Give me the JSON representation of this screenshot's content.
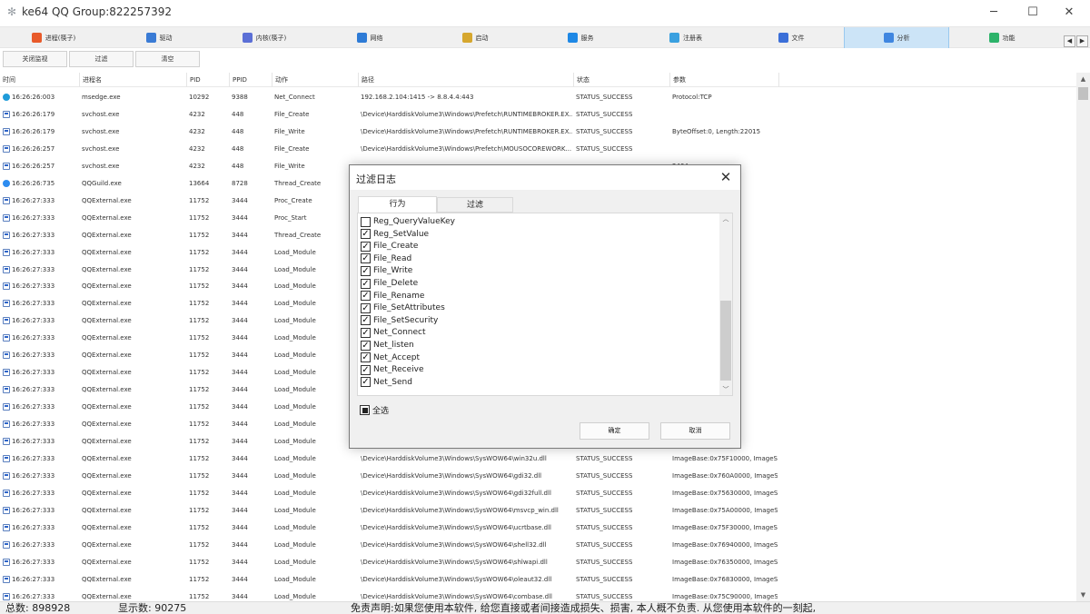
{
  "window": {
    "title": "ke64 QQ Group:822257392",
    "app_icon": "gear-icon",
    "minimize": "─",
    "maximize": "☐",
    "close": "✕"
  },
  "tabs": [
    {
      "label": "进程(筷子)",
      "icon": "windows-icon",
      "color": "#e85a2a"
    },
    {
      "label": "驱动",
      "icon": "gear-icon",
      "color": "#3a7bd5"
    },
    {
      "label": "内核(筷子)",
      "icon": "chip-icon",
      "color": "#5b6fd6"
    },
    {
      "label": "网络",
      "icon": "network-icon",
      "color": "#2e7bd6"
    },
    {
      "label": "启动",
      "icon": "rocket-icon",
      "color": "#d6a72e"
    },
    {
      "label": "服务",
      "icon": "services-icon",
      "color": "#1e88e5"
    },
    {
      "label": "注册表",
      "icon": "registry-icon",
      "color": "#3aa0e0"
    },
    {
      "label": "文件",
      "icon": "file-icon",
      "color": "#3b6fd8"
    },
    {
      "label": "分析",
      "icon": "analysis-icon",
      "color": "#3f86e0"
    },
    {
      "label": "功能",
      "icon": "function-icon",
      "color": "#2db36a"
    }
  ],
  "active_tab": "分析",
  "tab_nav": {
    "prev": "◀",
    "next": "▶"
  },
  "toolbar": {
    "close_monitor": "关闭监视",
    "filter": "过滤",
    "clear": "清空"
  },
  "columns": [
    "时间",
    "进程名",
    "PID",
    "PPID",
    "动作",
    "路径",
    "状态",
    "参数"
  ],
  "rows": [
    {
      "icon": "edge",
      "time": "16:26:26:003",
      "proc": "msedge.exe",
      "pid": "10292",
      "ppid": "9388",
      "action": "Net_Connect",
      "path": "192.168.2.104:1415  ->  8.8.4.4:443",
      "status": "STATUS_SUCCESS",
      "param": "Protocol:TCP"
    },
    {
      "icon": "exe",
      "time": "16:26:26:179",
      "proc": "svchost.exe",
      "pid": "4232",
      "ppid": "448",
      "action": "File_Create",
      "path": "\\Device\\HarddiskVolume3\\Windows\\Prefetch\\RUNTIMEBROKER.EX...",
      "status": "STATUS_SUCCESS",
      "param": ""
    },
    {
      "icon": "exe",
      "time": "16:26:26:179",
      "proc": "svchost.exe",
      "pid": "4232",
      "ppid": "448",
      "action": "File_Write",
      "path": "\\Device\\HarddiskVolume3\\Windows\\Prefetch\\RUNTIMEBROKER.EX...",
      "status": "STATUS_SUCCESS",
      "param": "ByteOffset:0, Length:22015"
    },
    {
      "icon": "exe",
      "time": "16:26:26:257",
      "proc": "svchost.exe",
      "pid": "4232",
      "ppid": "448",
      "action": "File_Create",
      "path": "\\Device\\HarddiskVolume3\\Windows\\Prefetch\\MOUSOCOREWORK...",
      "status": "STATUS_SUCCESS",
      "param": ""
    },
    {
      "icon": "exe",
      "time": "16:26:26:257",
      "proc": "svchost.exe",
      "pid": "4232",
      "ppid": "448",
      "action": "File_Write",
      "path": "",
      "status": "",
      "param": "2464"
    },
    {
      "icon": "guild",
      "time": "16:26:26:735",
      "proc": "QQGuild.exe",
      "pid": "13664",
      "ppid": "8728",
      "action": "Thread_Create",
      "path": "",
      "status": "",
      "param": ""
    },
    {
      "icon": "exe",
      "time": "16:26:27:333",
      "proc": "QQExternal.exe",
      "pid": "11752",
      "ppid": "3444",
      "action": "Proc_Create",
      "path": "",
      "status": "",
      "param": ""
    },
    {
      "icon": "exe",
      "time": "16:26:27:333",
      "proc": "QQExternal.exe",
      "pid": "11752",
      "ppid": "3444",
      "action": "Proc_Start",
      "path": "",
      "status": "",
      "param": ""
    },
    {
      "icon": "exe",
      "time": "16:26:27:333",
      "proc": "QQExternal.exe",
      "pid": "11752",
      "ppid": "3444",
      "action": "Thread_Create",
      "path": "",
      "status": "",
      "param": ""
    },
    {
      "icon": "exe",
      "time": "16:26:27:333",
      "proc": "QQExternal.exe",
      "pid": "11752",
      "ppid": "3444",
      "action": "Load_Module",
      "path": "",
      "status": "",
      "param": "ImageSize..."
    },
    {
      "icon": "exe",
      "time": "16:26:27:333",
      "proc": "QQExternal.exe",
      "pid": "11752",
      "ppid": "3444",
      "action": "Load_Module",
      "path": "",
      "status": "",
      "param": "0000, Im..."
    },
    {
      "icon": "exe",
      "time": "16:26:27:333",
      "proc": "QQExternal.exe",
      "pid": "11752",
      "ppid": "3444",
      "action": "Load_Module",
      "path": "",
      "status": "",
      "param": "0, ImageS..."
    },
    {
      "icon": "exe",
      "time": "16:26:27:333",
      "proc": "QQExternal.exe",
      "pid": "11752",
      "ppid": "3444",
      "action": "Load_Module",
      "path": "",
      "status": "",
      "param": "0000, Ima..."
    },
    {
      "icon": "exe",
      "time": "16:26:27:333",
      "proc": "QQExternal.exe",
      "pid": "11752",
      "ppid": "3444",
      "action": "Load_Module",
      "path": "",
      "status": "",
      "param": "0000, Ima..."
    },
    {
      "icon": "exe",
      "time": "16:26:27:333",
      "proc": "QQExternal.exe",
      "pid": "11752",
      "ppid": "3444",
      "action": "Load_Module",
      "path": "",
      "status": "",
      "param": "0, ImageSi..."
    },
    {
      "icon": "exe",
      "time": "16:26:27:333",
      "proc": "QQExternal.exe",
      "pid": "11752",
      "ppid": "3444",
      "action": "Load_Module",
      "path": "",
      "status": "",
      "param": "0, ImageSi..."
    },
    {
      "icon": "exe",
      "time": "16:26:27:333",
      "proc": "QQExternal.exe",
      "pid": "11752",
      "ppid": "3444",
      "action": "Load_Module",
      "path": "",
      "status": "",
      "param": "0, ImageSi..."
    },
    {
      "icon": "exe",
      "time": "16:26:27:333",
      "proc": "QQExternal.exe",
      "pid": "11752",
      "ppid": "3444",
      "action": "Load_Module",
      "path": "",
      "status": "",
      "param": "0, ImageS..."
    },
    {
      "icon": "exe",
      "time": "16:26:27:333",
      "proc": "QQExternal.exe",
      "pid": "11752",
      "ppid": "3444",
      "action": "Load_Module",
      "path": "",
      "status": "",
      "param": "0, ImageSi..."
    },
    {
      "icon": "exe",
      "time": "16:26:27:333",
      "proc": "QQExternal.exe",
      "pid": "11752",
      "ppid": "3444",
      "action": "Load_Module",
      "path": "",
      "status": "",
      "param": "0, ImageSi..."
    },
    {
      "icon": "exe",
      "time": "16:26:27:333",
      "proc": "QQExternal.exe",
      "pid": "11752",
      "ppid": "3444",
      "action": "Load_Module",
      "path": "",
      "status": "",
      "param": "0, ImageSi..."
    },
    {
      "icon": "exe",
      "time": "16:26:27:333",
      "proc": "QQExternal.exe",
      "pid": "11752",
      "ppid": "3444",
      "action": "Load_Module",
      "path": "\\Device\\HarddiskVolume3\\Windows\\SysWOW64\\win32u.dll",
      "status": "STATUS_SUCCESS",
      "param": "ImageBase:0x75F10000, ImageSi..."
    },
    {
      "icon": "exe",
      "time": "16:26:27:333",
      "proc": "QQExternal.exe",
      "pid": "11752",
      "ppid": "3444",
      "action": "Load_Module",
      "path": "\\Device\\HarddiskVolume3\\Windows\\SysWOW64\\gdi32.dll",
      "status": "STATUS_SUCCESS",
      "param": "ImageBase:0x760A0000, ImageSi..."
    },
    {
      "icon": "exe",
      "time": "16:26:27:333",
      "proc": "QQExternal.exe",
      "pid": "11752",
      "ppid": "3444",
      "action": "Load_Module",
      "path": "\\Device\\HarddiskVolume3\\Windows\\SysWOW64\\gdi32full.dll",
      "status": "STATUS_SUCCESS",
      "param": "ImageBase:0x75630000, ImageSi..."
    },
    {
      "icon": "exe",
      "time": "16:26:27:333",
      "proc": "QQExternal.exe",
      "pid": "11752",
      "ppid": "3444",
      "action": "Load_Module",
      "path": "\\Device\\HarddiskVolume3\\Windows\\SysWOW64\\msvcp_win.dll",
      "status": "STATUS_SUCCESS",
      "param": "ImageBase:0x75A00000, ImageSi..."
    },
    {
      "icon": "exe",
      "time": "16:26:27:333",
      "proc": "QQExternal.exe",
      "pid": "11752",
      "ppid": "3444",
      "action": "Load_Module",
      "path": "\\Device\\HarddiskVolume3\\Windows\\SysWOW64\\ucrtbase.dll",
      "status": "STATUS_SUCCESS",
      "param": "ImageBase:0x75F30000, ImageSi..."
    },
    {
      "icon": "exe",
      "time": "16:26:27:333",
      "proc": "QQExternal.exe",
      "pid": "11752",
      "ppid": "3444",
      "action": "Load_Module",
      "path": "\\Device\\HarddiskVolume3\\Windows\\SysWOW64\\shell32.dll",
      "status": "STATUS_SUCCESS",
      "param": "ImageBase:0x76940000, ImageSi..."
    },
    {
      "icon": "exe",
      "time": "16:26:27:333",
      "proc": "QQExternal.exe",
      "pid": "11752",
      "ppid": "3444",
      "action": "Load_Module",
      "path": "\\Device\\HarddiskVolume3\\Windows\\SysWOW64\\shlwapi.dll",
      "status": "STATUS_SUCCESS",
      "param": "ImageBase:0x76350000, ImageSi..."
    },
    {
      "icon": "exe",
      "time": "16:26:27:333",
      "proc": "QQExternal.exe",
      "pid": "11752",
      "ppid": "3444",
      "action": "Load_Module",
      "path": "\\Device\\HarddiskVolume3\\Windows\\SysWOW64\\oleaut32.dll",
      "status": "STATUS_SUCCESS",
      "param": "ImageBase:0x76830000, ImageSi..."
    },
    {
      "icon": "exe",
      "time": "16:26:27:333",
      "proc": "QQExternal.exe",
      "pid": "11752",
      "ppid": "3444",
      "action": "Load_Module",
      "path": "\\Device\\HarddiskVolume3\\Windows\\SysWOW64\\combase.dll",
      "status": "STATUS_SUCCESS",
      "param": "ImageBase:0x75C90000, ImageSi..."
    }
  ],
  "statusbar": {
    "total": "总数: 898928",
    "shown": "显示数: 90275",
    "disclaimer": "免责声明:如果您使用本软件, 给您直接或者间接造成损失、损害, 本人概不负责. 从您使用本软件的一刻起,"
  },
  "dialog": {
    "title": "过滤日志",
    "close": "✕",
    "tabs": [
      "行为",
      "过滤"
    ],
    "active_tab": "行为",
    "items": [
      {
        "label": "Reg_QueryValueKey",
        "checked": false
      },
      {
        "label": "Reg_SetValue",
        "checked": true
      },
      {
        "label": "File_Create",
        "checked": true
      },
      {
        "label": "File_Read",
        "checked": true
      },
      {
        "label": "File_Write",
        "checked": true
      },
      {
        "label": "File_Delete",
        "checked": true
      },
      {
        "label": "File_Rename",
        "checked": true
      },
      {
        "label": "File_SetAttributes",
        "checked": true
      },
      {
        "label": "File_SetSecurity",
        "checked": true
      },
      {
        "label": "Net_Connect",
        "checked": true
      },
      {
        "label": "Net_listen",
        "checked": true
      },
      {
        "label": "Net_Accept",
        "checked": true
      },
      {
        "label": "Net_Receive",
        "checked": true
      },
      {
        "label": "Net_Send",
        "checked": true
      }
    ],
    "scroll_up": "︿",
    "scroll_down": "﹀",
    "select_all": "全选",
    "select_all_state": "indeterminate",
    "ok": "确定",
    "cancel": "取消"
  }
}
